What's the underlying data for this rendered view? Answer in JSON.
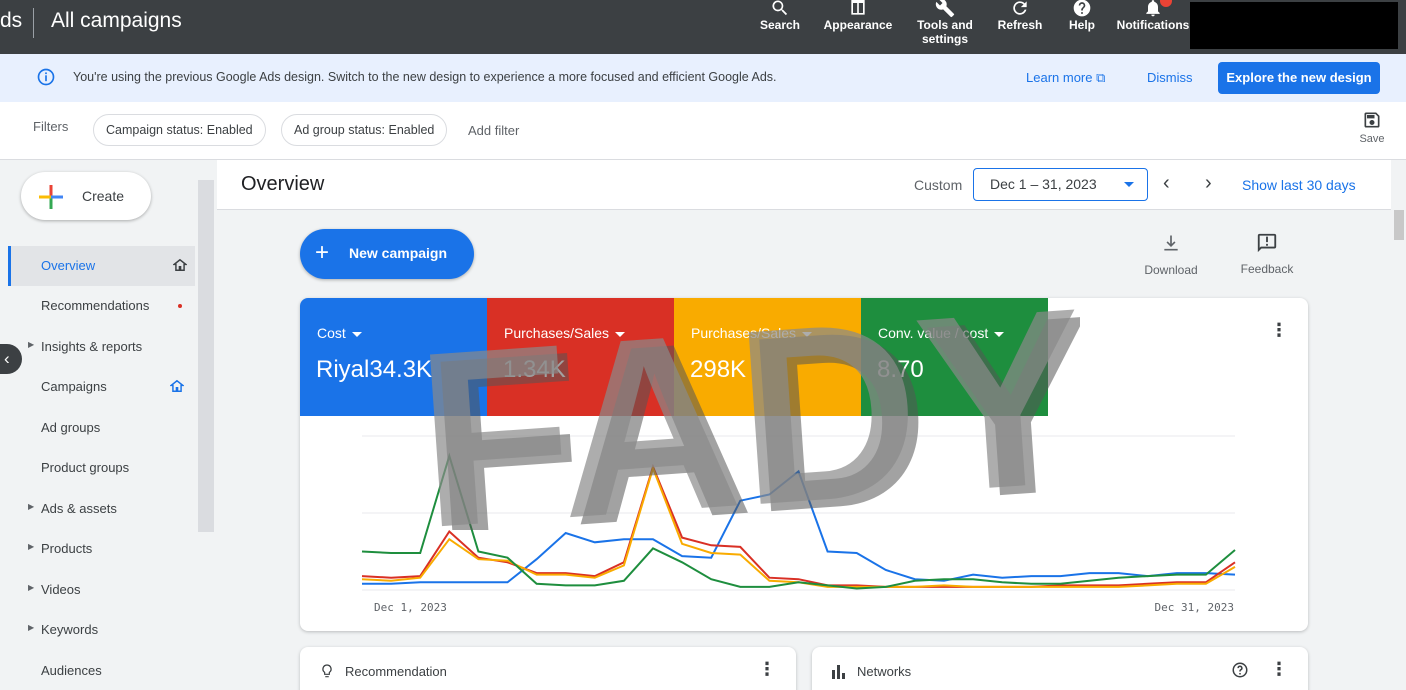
{
  "topbar": {
    "brand_fragment": "ds",
    "title": "All campaigns",
    "tools": [
      {
        "label": "Search",
        "icon": "search-icon"
      },
      {
        "label": "Appearance",
        "icon": "appearance-icon"
      },
      {
        "label": "Tools and settings",
        "icon": "wrench-icon"
      },
      {
        "label": "Refresh",
        "icon": "refresh-icon"
      },
      {
        "label": "Help",
        "icon": "help-icon"
      },
      {
        "label": "Notifications",
        "icon": "bell-icon"
      }
    ]
  },
  "banner": {
    "message": "You're using the previous Google Ads design. Switch to the new design to experience a more focused and efficient Google Ads.",
    "learn_more": "Learn more",
    "dismiss": "Dismiss",
    "explore": "Explore the new design"
  },
  "filters": {
    "label": "Filters",
    "chips": [
      "Campaign status: Enabled",
      "Ad group status: Enabled"
    ],
    "add_filter": "Add filter",
    "save": "Save"
  },
  "nav": {
    "create": "Create",
    "items": [
      {
        "label": "Overview",
        "active": true,
        "home": true
      },
      {
        "label": "Recommendations",
        "dot": true
      },
      {
        "label": "Insights & reports",
        "expandable": true
      },
      {
        "label": "Campaigns",
        "home": true
      },
      {
        "label": "Ad groups"
      },
      {
        "label": "Product groups"
      },
      {
        "label": "Ads & assets",
        "expandable": true
      },
      {
        "label": "Products",
        "expandable": true
      },
      {
        "label": "Videos",
        "expandable": true
      },
      {
        "label": "Keywords",
        "expandable": true
      },
      {
        "label": "Audiences"
      }
    ]
  },
  "overview": {
    "title": "Overview",
    "custom": "Custom",
    "date_range": "Dec 1 – 31, 2023",
    "show_last": "Show last 30 days",
    "new_campaign": "New campaign",
    "download": "Download",
    "feedback": "Feedback"
  },
  "metrics": [
    {
      "label": "Cost",
      "value": "Riyal34.3K",
      "color": "#1a73e8"
    },
    {
      "label": "Purchases/Sales",
      "value": "1.34K",
      "color": "#d93025"
    },
    {
      "label": "Purchases/Sales",
      "value": "298K",
      "color": "#f9ab00"
    },
    {
      "label": "Conv. value / cost",
      "value": "8.70",
      "color": "#1e8e3e"
    }
  ],
  "chart_data": {
    "type": "line",
    "x_start_label": "Dec 1, 2023",
    "x_end_label": "Dec 31, 2023",
    "grid": true,
    "ylim": [
      0,
      100
    ],
    "series": [
      {
        "name": "Cost",
        "color": "#1a73e8",
        "values": [
          4,
          4,
          5,
          5,
          5,
          5,
          20,
          37,
          31,
          33,
          33,
          22,
          21,
          58,
          62,
          77,
          25,
          24,
          13,
          7,
          6,
          10,
          8,
          9,
          9,
          11,
          11,
          9,
          11,
          11,
          10
        ]
      },
      {
        "name": "Purchases/Sales",
        "color": "#d93025",
        "values": [
          9,
          8,
          9,
          38,
          21,
          18,
          11,
          11,
          9,
          18,
          80,
          34,
          29,
          28,
          8,
          7,
          3,
          3,
          2,
          2,
          2,
          2,
          2,
          2,
          3,
          3,
          3,
          4,
          5,
          5,
          18
        ]
      },
      {
        "name": "Purchases/Sales",
        "color": "#f9ab00",
        "values": [
          7,
          6,
          8,
          33,
          20,
          19,
          10,
          10,
          8,
          16,
          79,
          30,
          24,
          23,
          6,
          5,
          2,
          2,
          2,
          2,
          3,
          2,
          2,
          2,
          2,
          2,
          2,
          3,
          4,
          4,
          15
        ]
      },
      {
        "name": "Conv. value / cost",
        "color": "#1e8e3e",
        "values": [
          25,
          24,
          24,
          87,
          25,
          21,
          4,
          3,
          3,
          6,
          27,
          18,
          7,
          2,
          2,
          5,
          3,
          1,
          2,
          6,
          7,
          7,
          5,
          4,
          4,
          6,
          8,
          9,
          10,
          10,
          26
        ]
      }
    ]
  },
  "watermark": "FADY",
  "bottom_cards": [
    {
      "label": "Recommendation"
    },
    {
      "label": "Networks"
    }
  ]
}
